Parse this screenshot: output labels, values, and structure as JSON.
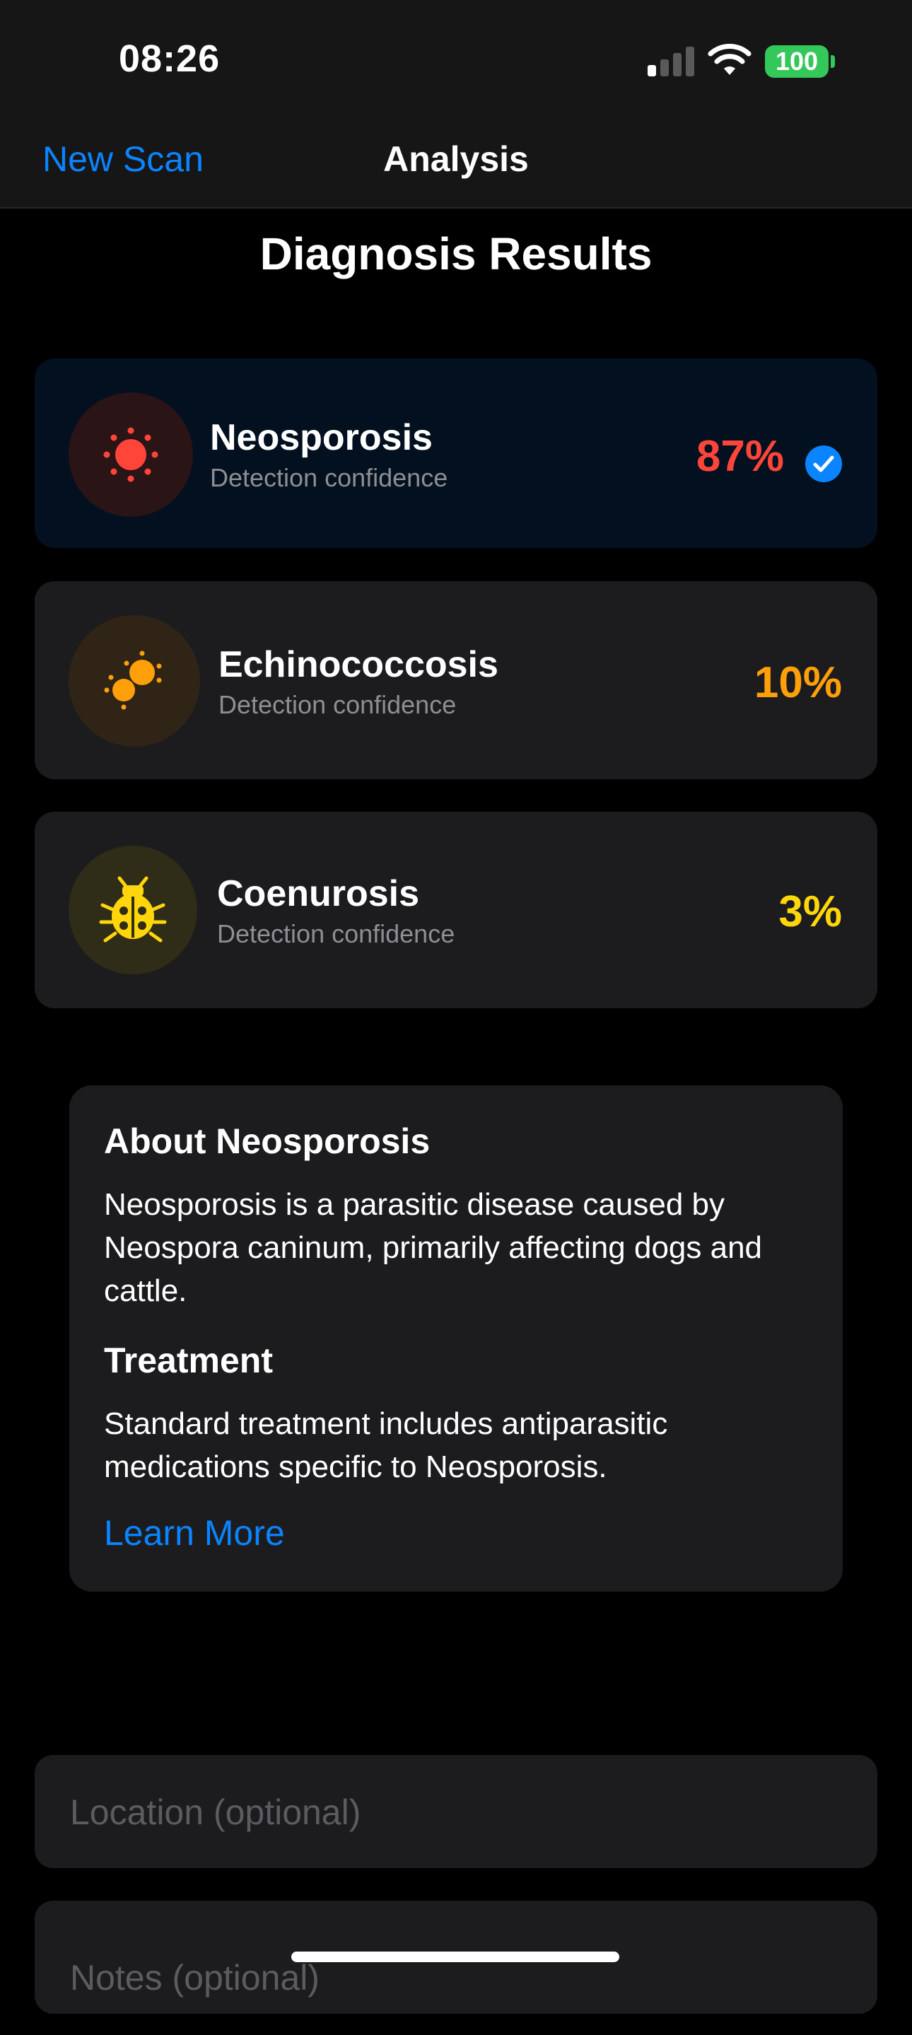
{
  "status_bar": {
    "time": "08:26",
    "battery": "100",
    "signal_bars_active": 1,
    "signal_bars_total": 4
  },
  "nav": {
    "back_label": "New Scan",
    "title": "Analysis"
  },
  "page_heading": "Diagnosis Results",
  "results": [
    {
      "name": "Neosporosis",
      "subtitle": "Detection confidence",
      "confidence": "87%",
      "color": "#ff453a",
      "icon": "sun-icon",
      "selected": true
    },
    {
      "name": "Echinococcosis",
      "subtitle": "Detection confidence",
      "confidence": "10%",
      "color": "#ff9f0a",
      "icon": "circles-icon",
      "selected": false
    },
    {
      "name": "Coenurosis",
      "subtitle": "Detection confidence",
      "confidence": "3%",
      "color": "#ffd60a",
      "icon": "ladybug-icon",
      "selected": false
    }
  ],
  "about": {
    "title": "About Neosporosis",
    "text": "Neosporosis is a parasitic disease caused by Neospora caninum, primarily affecting dogs and cattle.",
    "treatment_title": "Treatment",
    "treatment_text": "Standard treatment includes antiparasitic medications specific to Neosporosis.",
    "learn_more": "Learn More"
  },
  "fields": {
    "location_placeholder": "Location (optional)",
    "notes_placeholder": "Notes (optional)"
  },
  "colors": {
    "accent": "#0a84ff",
    "battery": "#34c759"
  }
}
